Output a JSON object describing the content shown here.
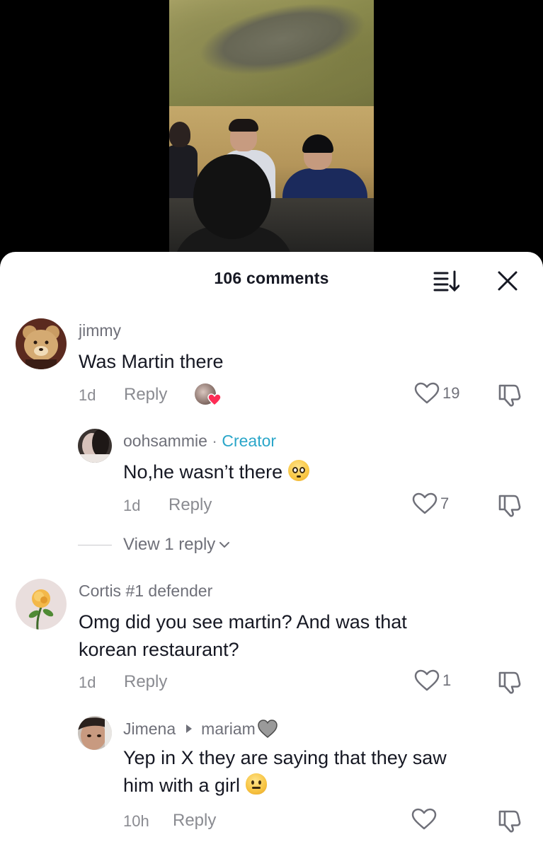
{
  "video": {
    "description": ""
  },
  "header": {
    "count_label": "106 comments"
  },
  "icons": {
    "sort": "sort-icon",
    "close": "close-icon",
    "heart": "heart-outline-icon",
    "dislike": "thumbs-down-icon",
    "chevron": "chevron-down-icon"
  },
  "colors": {
    "creator": "#2aa6c9",
    "muted": "#8a8b91",
    "text": "#161823"
  },
  "comments": [
    {
      "username": "jimmy",
      "text": "Was Martin there",
      "time": "1d",
      "reply_label": "Reply",
      "likes": "19",
      "liked_by_creator": true
    },
    {
      "username": "oohsammie",
      "separator": "·",
      "badge": "Creator",
      "text": "No,he wasn’t there",
      "time": "1d",
      "reply_label": "Reply",
      "likes": "7"
    },
    {
      "view_replies_label": "View 1 reply"
    },
    {
      "username": "Cortis #1 defender",
      "text_line1": "Omg did you see martin? And was that",
      "text_line2": "korean restaurant?",
      "time": "1d",
      "reply_label": "Reply",
      "likes": "1"
    },
    {
      "username": "Jimena",
      "reply_to": "mariam",
      "text_line1": "Yep in X they are saying that they saw",
      "text_line2": "him with a girl",
      "time": "10h",
      "reply_label": "Reply",
      "likes": ""
    }
  ]
}
